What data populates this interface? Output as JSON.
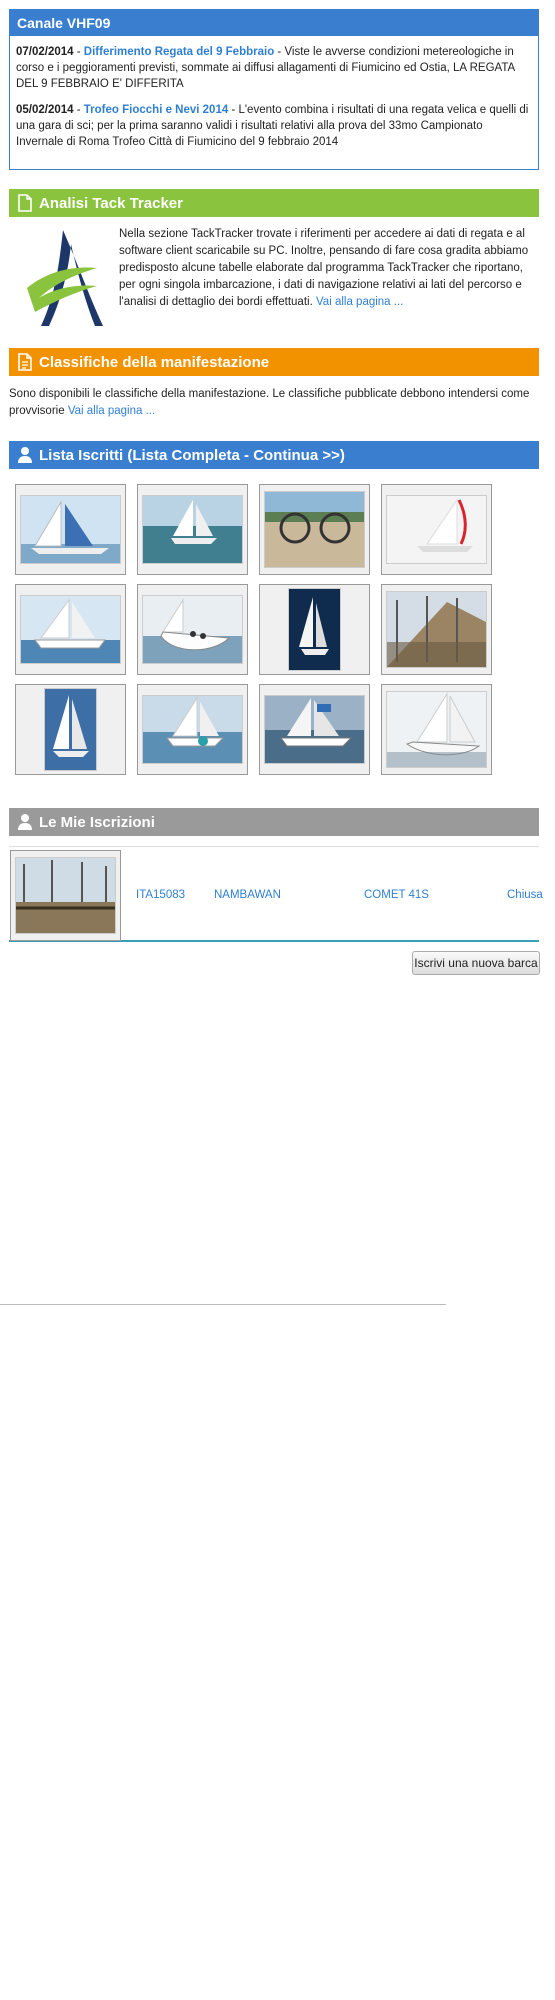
{
  "vhf": {
    "title": "Canale VHF09",
    "items": [
      {
        "date": "07/02/2014",
        "sep": " - ",
        "title": "Differimento Regata del 9 Febbraio",
        "text": " - Viste le avverse condizioni metereologiche in corso e i peggioramenti previsti, sommate ai diffusi allagamenti di Fiumicino ed Ostia, LA REGATA DEL 9 FEBBRAIO E' DIFFERITA"
      },
      {
        "date": "05/02/2014",
        "sep": " - ",
        "title": "Trofeo Fiocchi e Nevi 2014",
        "text": " - L'evento combina i risultati di una regata velica e quelli di una gara di sci; per la prima saranno validi i risultati relativi alla prova del 33mo Campionato Invernale di Roma Trofeo Città di Fiumicino del 9 febbraio 2014"
      }
    ]
  },
  "tack": {
    "title": "Analisi Tack Tracker",
    "text": "Nella sezione TackTracker trovate i riferimenti per accedere ai dati di regata e al software client scaricabile su PC. Inoltre, pensando di fare cosa gradita abbiamo predisposto alcune tabelle elaborate dal programma TackTracker che riportano, per ogni singola imbarcazione, i dati di navigazione relativi ai lati del percorso e l'analisi di dettaglio dei bordi effettuati. ",
    "link": "Vai alla pagina ..."
  },
  "classifiche": {
    "title": "Classifiche della manifestazione",
    "text": "Sono disponibili le classifiche della manifestazione. Le classifiche pubblicate debbono intendersi come provvisorie ",
    "link": "Vai alla pagina ..."
  },
  "iscritti": {
    "title": "Lista Iscritti (Lista Completa - Continua >>)",
    "photos": [
      "boat-photo-1",
      "boat-photo-2",
      "boat-photo-3",
      "boat-photo-4",
      "boat-photo-5",
      "boat-photo-6",
      "boat-photo-7",
      "boat-photo-8",
      "boat-photo-9",
      "boat-photo-10",
      "boat-photo-11",
      "boat-photo-12"
    ]
  },
  "mie": {
    "title": "Le Mie Iscrizioni",
    "row": {
      "sail": "ITA15083",
      "name": "NAMBAWAN",
      "model": "COMET 41S",
      "status": "Chiusa"
    },
    "button": "Iscrivi una nuova barca"
  },
  "colors": {
    "blue": "#3a7ecf",
    "green": "#8ac43f",
    "orange": "#f39200",
    "grey": "#9a9a9a",
    "link": "#2f7fd2"
  }
}
